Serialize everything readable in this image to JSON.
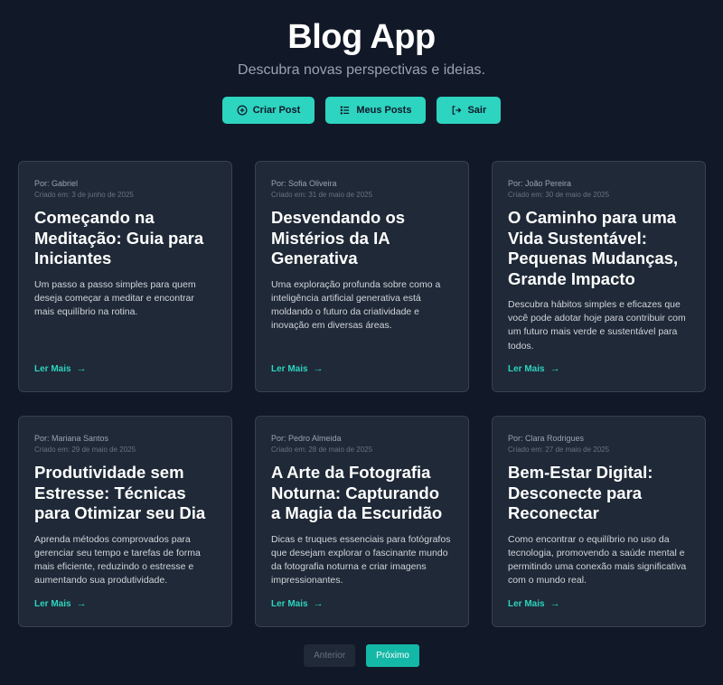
{
  "header": {
    "title": "Blog App",
    "subtitle": "Descubra novas perspectivas e ideias."
  },
  "actions": {
    "create_label": "Criar Post",
    "my_posts_label": "Meus Posts",
    "logout_label": "Sair",
    "create_icon": "plus-circle-icon",
    "my_posts_icon": "list-icon",
    "logout_icon": "logout-icon"
  },
  "posts": [
    {
      "author": "Por: Gabriel",
      "date": "Criado em: 3 de junho de 2025",
      "title": "Começando na Meditação: Guia para Iniciantes",
      "excerpt": "Um passo a passo simples para quem deseja começar a meditar e encontrar mais equilíbrio na rotina.",
      "read_more": "Ler Mais"
    },
    {
      "author": "Por: Sofia Oliveira",
      "date": "Criado em: 31 de maio de 2025",
      "title": "Desvendando os Mistérios da IA Generativa",
      "excerpt": "Uma exploração profunda sobre como a inteligência artificial generativa está moldando o futuro da criatividade e inovação em diversas áreas.",
      "read_more": "Ler Mais"
    },
    {
      "author": "Por: João Pereira",
      "date": "Criado em: 30 de maio de 2025",
      "title": "O Caminho para uma Vida Sustentável: Pequenas Mudanças, Grande Impacto",
      "excerpt": "Descubra hábitos simples e eficazes que você pode adotar hoje para contribuir com um futuro mais verde e sustentável para todos.",
      "read_more": "Ler Mais"
    },
    {
      "author": "Por: Mariana Santos",
      "date": "Criado em: 29 de maio de 2025",
      "title": "Produtividade sem Estresse: Técnicas para Otimizar seu Dia",
      "excerpt": "Aprenda métodos comprovados para gerenciar seu tempo e tarefas de forma mais eficiente, reduzindo o estresse e aumentando sua produtividade.",
      "read_more": "Ler Mais"
    },
    {
      "author": "Por: Pedro Almeida",
      "date": "Criado em: 28 de maio de 2025",
      "title": "A Arte da Fotografia Noturna: Capturando a Magia da Escuridão",
      "excerpt": "Dicas e truques essenciais para fotógrafos que desejam explorar o fascinante mundo da fotografia noturna e criar imagens impressionantes.",
      "read_more": "Ler Mais"
    },
    {
      "author": "Por: Clara Rodrigues",
      "date": "Criado em: 27 de maio de 2025",
      "title": "Bem-Estar Digital: Desconecte para Reconectar",
      "excerpt": "Como encontrar o equilíbrio no uso da tecnologia, promovendo a saúde mental e permitindo uma conexão mais significativa com o mundo real.",
      "read_more": "Ler Mais"
    }
  ],
  "pagination": {
    "prev_label": "Anterior",
    "next_label": "Próximo"
  },
  "colors": {
    "background": "#111827",
    "card": "#1f2937",
    "accent": "#2dd4bf"
  }
}
